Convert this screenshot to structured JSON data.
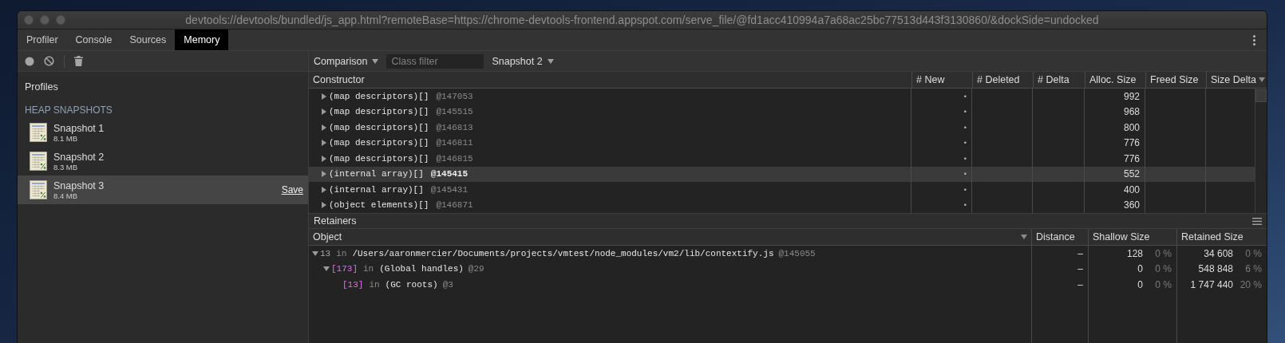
{
  "window": {
    "title": "devtools://devtools/bundled/js_app.html?remoteBase=https://chrome-devtools-frontend.appspot.com/serve_file/@fd1acc410994a7a68ac25bc77513d443f3130860/&dockSide=undocked"
  },
  "tabs": [
    {
      "label": "Profiler",
      "selected": false
    },
    {
      "label": "Console",
      "selected": false
    },
    {
      "label": "Sources",
      "selected": false
    },
    {
      "label": "Memory",
      "selected": true
    }
  ],
  "sidebar": {
    "title": "Profiles",
    "section": "HEAP SNAPSHOTS",
    "snapshots": [
      {
        "name": "Snapshot 1",
        "size": "8.1 MB",
        "selected": false
      },
      {
        "name": "Snapshot 2",
        "size": "8.3 MB",
        "selected": false
      },
      {
        "name": "Snapshot 3",
        "size": "8.4 MB",
        "selected": true,
        "action": "Save"
      }
    ]
  },
  "view_toolbar": {
    "mode": "Comparison",
    "class_filter": {
      "placeholder": "Class filter"
    },
    "baseline": "Snapshot 2"
  },
  "table": {
    "columns": [
      {
        "label": "Constructor",
        "sorted": false
      },
      {
        "label": "# New",
        "sorted": false
      },
      {
        "label": "# Deleted",
        "sorted": false
      },
      {
        "label": "# Delta",
        "sorted": false
      },
      {
        "label": "Alloc. Size",
        "sorted": false
      },
      {
        "label": "Freed Size",
        "sorted": false
      },
      {
        "label": "Size Delta",
        "sorted": true
      }
    ],
    "rows": [
      {
        "constructor": "(map descriptors)[]",
        "id": "@147053",
        "new": "•",
        "alloc_size": "992",
        "expanded": false,
        "selected": false
      },
      {
        "constructor": "(map descriptors)[]",
        "id": "@145515",
        "new": "•",
        "alloc_size": "968",
        "expanded": false,
        "selected": false
      },
      {
        "constructor": "(map descriptors)[]",
        "id": "@146813",
        "new": "•",
        "alloc_size": "800",
        "expanded": false,
        "selected": false
      },
      {
        "constructor": "(map descriptors)[]",
        "id": "@146811",
        "new": "•",
        "alloc_size": "776",
        "expanded": false,
        "selected": false
      },
      {
        "constructor": "(map descriptors)[]",
        "id": "@146815",
        "new": "•",
        "alloc_size": "776",
        "expanded": false,
        "selected": false
      },
      {
        "constructor": "(internal array)[]",
        "id": "@145415",
        "new": "•",
        "alloc_size": "552",
        "expanded": false,
        "selected": true
      },
      {
        "constructor": "(internal array)[]",
        "id": "@145431",
        "new": "•",
        "alloc_size": "400",
        "expanded": false,
        "selected": false
      },
      {
        "constructor": "(object elements)[]",
        "id": "@146871",
        "new": "•",
        "alloc_size": "360",
        "expanded": false,
        "selected": false
      }
    ]
  },
  "retainers": {
    "title": "Retainers",
    "columns": [
      {
        "label": "Object",
        "sorted": true
      },
      {
        "label": "Distance",
        "sorted": false
      },
      {
        "label": "Shallow Size",
        "sorted": false
      },
      {
        "label": "Retained Size",
        "sorted": false
      }
    ],
    "rows": [
      {
        "name": "13",
        "kind": "property",
        "connector": "in",
        "object": "/Users/aaronmercier/Documents/projects/vmtest/node_modules/vm2/lib/contextify.js",
        "id": "@145055",
        "distance": "–",
        "shallow": "128",
        "shallow_pct": "0 %",
        "retained": "34 608",
        "retained_pct": "0 %",
        "expanded": true,
        "children": [
          {
            "name": "[173]",
            "kind": "element",
            "connector": "in",
            "object": "(Global handles)",
            "id": "@29",
            "distance": "–",
            "shallow": "0",
            "shallow_pct": "0 %",
            "retained": "548 848",
            "retained_pct": "6 %",
            "expanded": true,
            "children": [
              {
                "name": "[13]",
                "kind": "element",
                "connector": "in",
                "object": "(GC roots)",
                "id": "@3",
                "distance": "–",
                "shallow": "0",
                "shallow_pct": "0 %",
                "retained": "1 747 440",
                "retained_pct": "20 %"
              }
            ]
          }
        ]
      }
    ]
  }
}
